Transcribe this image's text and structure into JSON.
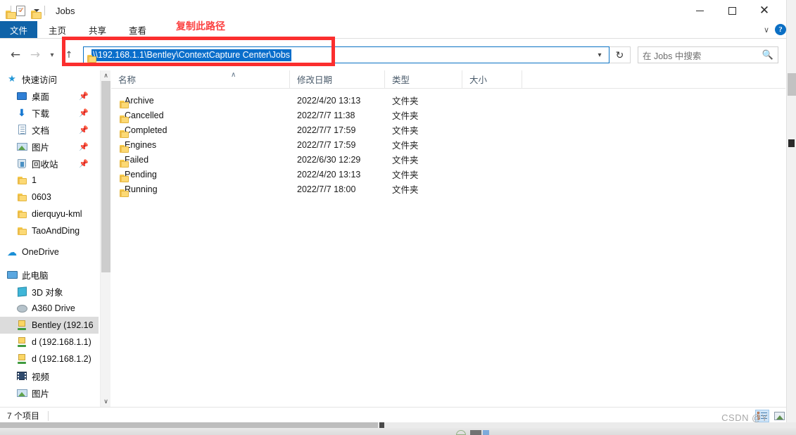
{
  "window": {
    "title": "Jobs",
    "quick_access": [
      {
        "name": "folder-icon",
        "label": ""
      },
      {
        "name": "properties-icon",
        "label": ""
      },
      {
        "name": "new-folder-icon",
        "label": ""
      },
      {
        "name": "customize-dropdown-icon",
        "label": ""
      }
    ],
    "controls": {
      "minimize": "—",
      "maximize": "□",
      "close": "✕"
    }
  },
  "ribbon": {
    "tabs": [
      {
        "label": "文件",
        "active": true
      },
      {
        "label": "主页",
        "active": false
      },
      {
        "label": "共享",
        "active": false
      },
      {
        "label": "查看",
        "active": false
      }
    ],
    "expand_icon": "chevron-down-icon",
    "help_label": "?"
  },
  "navigation": {
    "back_icon": "←",
    "forward_icon": "→",
    "history_icon": "ˇ",
    "up_icon": "↑",
    "address_value": "\\\\192.168.1.1\\Bentley\\ContextCapture Center\\Jobs",
    "address_dropdown_icon": "ˇ",
    "refresh_icon": "↻",
    "selection_color": "#0a6ecb",
    "focus_border_color": "#0a72c4"
  },
  "search": {
    "placeholder": "在 Jobs 中搜索",
    "value": "",
    "icon": "⌕"
  },
  "annotation": {
    "label": "复制此路径",
    "color": "#fb2e2e"
  },
  "sidebar": {
    "items": [
      {
        "label": "快速访问",
        "icon": "quick-access-star-icon",
        "indent": 0,
        "pinned": false,
        "selected": false
      },
      {
        "label": "桌面",
        "icon": "desktop-icon",
        "indent": 1,
        "pinned": true,
        "selected": false
      },
      {
        "label": "下载",
        "icon": "downloads-icon",
        "indent": 1,
        "pinned": true,
        "selected": false
      },
      {
        "label": "文档",
        "icon": "documents-icon",
        "indent": 1,
        "pinned": true,
        "selected": false
      },
      {
        "label": "图片",
        "icon": "pictures-icon",
        "indent": 1,
        "pinned": true,
        "selected": false
      },
      {
        "label": "回收站",
        "icon": "recycle-bin-icon",
        "indent": 1,
        "pinned": true,
        "selected": false
      },
      {
        "label": "1",
        "icon": "folder-icon",
        "indent": 1,
        "pinned": false,
        "selected": false
      },
      {
        "label": "0603",
        "icon": "folder-icon",
        "indent": 1,
        "pinned": false,
        "selected": false
      },
      {
        "label": "dierquyu-kml",
        "icon": "folder-icon",
        "indent": 1,
        "pinned": false,
        "selected": false
      },
      {
        "label": "TaoAndDing",
        "icon": "folder-icon",
        "indent": 1,
        "pinned": false,
        "selected": false
      },
      {
        "label": "OneDrive",
        "icon": "onedrive-cloud-icon",
        "indent": 0,
        "pinned": false,
        "selected": false
      },
      {
        "label": "此电脑",
        "icon": "this-pc-icon",
        "indent": 0,
        "pinned": false,
        "selected": false
      },
      {
        "label": "3D 对象",
        "icon": "3d-objects-icon",
        "indent": 1,
        "pinned": false,
        "selected": false
      },
      {
        "label": "A360 Drive",
        "icon": "a360-drive-icon",
        "indent": 1,
        "pinned": false,
        "selected": false
      },
      {
        "label": "Bentley (192.16",
        "icon": "network-drive-icon",
        "indent": 1,
        "pinned": false,
        "selected": true
      },
      {
        "label": "d (192.168.1.1)",
        "icon": "network-drive-icon",
        "indent": 1,
        "pinned": false,
        "selected": false
      },
      {
        "label": "d (192.168.1.2)",
        "icon": "network-drive-icon",
        "indent": 1,
        "pinned": false,
        "selected": false
      },
      {
        "label": "视频",
        "icon": "videos-icon",
        "indent": 1,
        "pinned": false,
        "selected": false
      },
      {
        "label": "图片",
        "icon": "pictures-icon",
        "indent": 1,
        "pinned": false,
        "selected": false
      }
    ],
    "scroll_up_icon": "∧",
    "scroll_down_icon": "∨"
  },
  "filelist": {
    "columns": [
      {
        "label": "名称",
        "sorted": "asc",
        "sort_icon": "∧"
      },
      {
        "label": "修改日期",
        "sorted": "",
        "sort_icon": ""
      },
      {
        "label": "类型",
        "sorted": "",
        "sort_icon": ""
      },
      {
        "label": "大小",
        "sorted": "",
        "sort_icon": ""
      }
    ],
    "rows": [
      {
        "name": "Archive",
        "date": "2022/4/20 13:13",
        "type": "文件夹",
        "size": ""
      },
      {
        "name": "Cancelled",
        "date": "2022/7/7 11:38",
        "type": "文件夹",
        "size": ""
      },
      {
        "name": "Completed",
        "date": "2022/7/7 17:59",
        "type": "文件夹",
        "size": ""
      },
      {
        "name": "Engines",
        "date": "2022/7/7 17:59",
        "type": "文件夹",
        "size": ""
      },
      {
        "name": "Failed",
        "date": "2022/6/30 12:29",
        "type": "文件夹",
        "size": ""
      },
      {
        "name": "Pending",
        "date": "2022/4/20 13:13",
        "type": "文件夹",
        "size": ""
      },
      {
        "name": "Running",
        "date": "2022/7/7 18:00",
        "type": "文件夹",
        "size": ""
      }
    ]
  },
  "statusbar": {
    "item_count": "7 个项目",
    "view_details_icon": "details-view-icon",
    "view_thumbnails_icon": "large-icons-view-icon"
  },
  "watermark": {
    "text": "CSDN @Y"
  }
}
